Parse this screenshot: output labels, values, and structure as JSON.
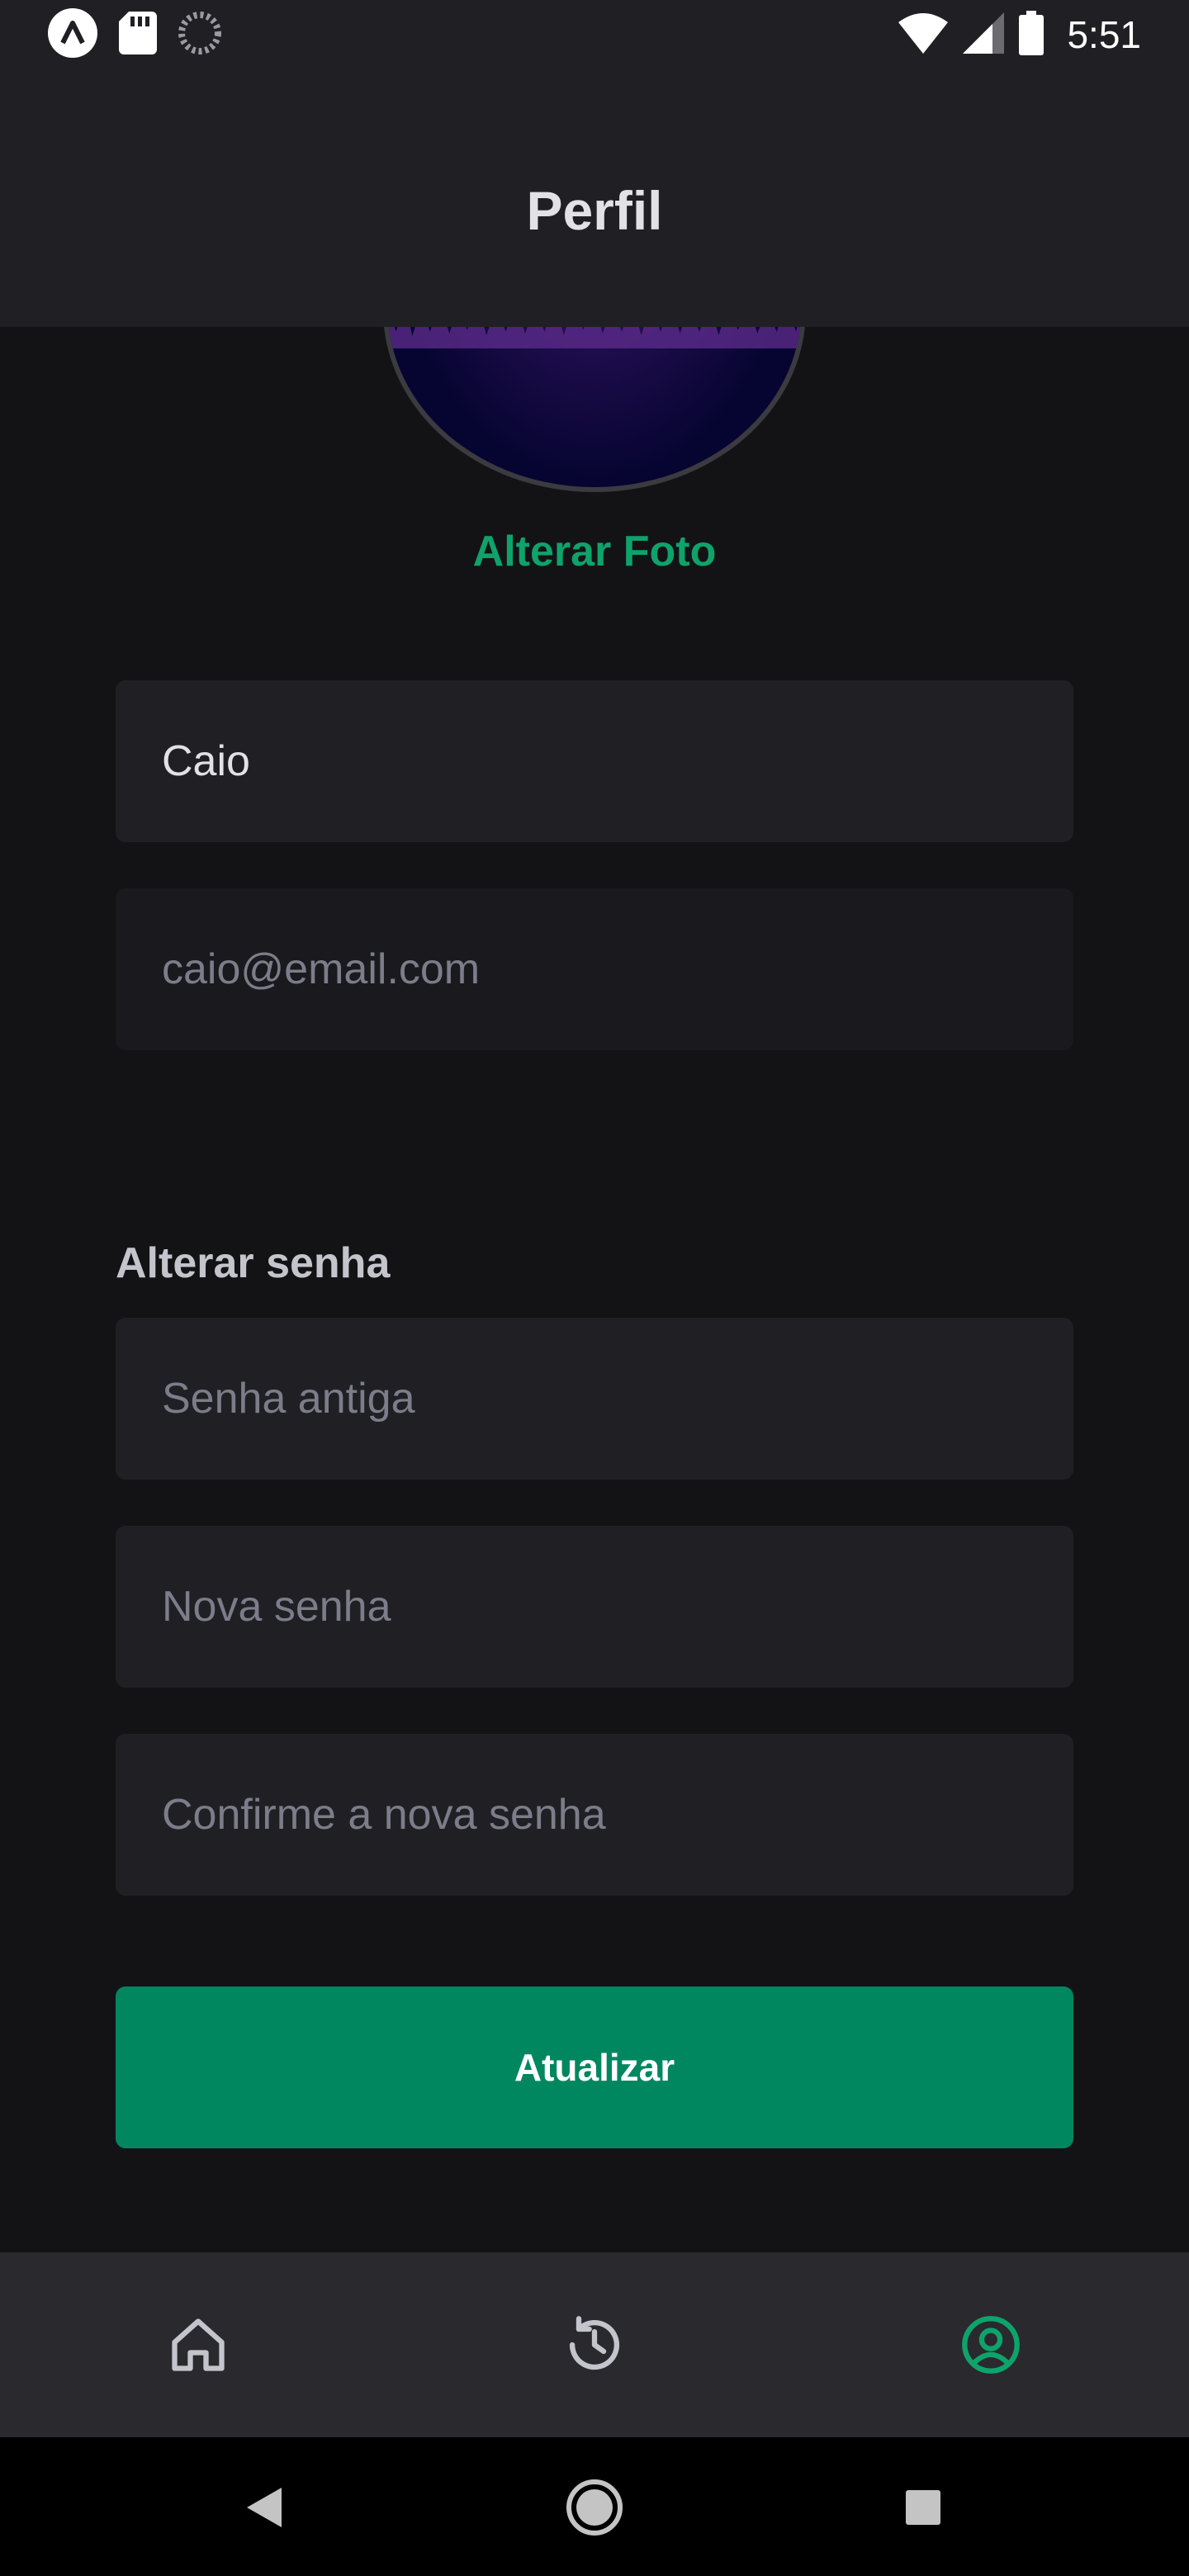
{
  "status_bar": {
    "time": "5:51"
  },
  "header": {
    "title": "Perfil"
  },
  "profile": {
    "change_photo_label": "Alterar Foto"
  },
  "form": {
    "name_value": "Caio",
    "email_placeholder": "caio@email.com",
    "password_section_label": "Alterar senha",
    "old_password_placeholder": "Senha antiga",
    "new_password_placeholder": "Nova senha",
    "confirm_password_placeholder": "Confirme a nova senha",
    "submit_label": "Atualizar"
  },
  "tabs": [
    {
      "icon": "home-icon",
      "active": false
    },
    {
      "icon": "history-icon",
      "active": false
    },
    {
      "icon": "user-circle-icon",
      "active": true
    }
  ],
  "colors": {
    "accent": "#0ea36b",
    "button": "#00875f",
    "background": "#131316",
    "surface": "#202024",
    "tab_inactive": "#c4c4cc"
  }
}
